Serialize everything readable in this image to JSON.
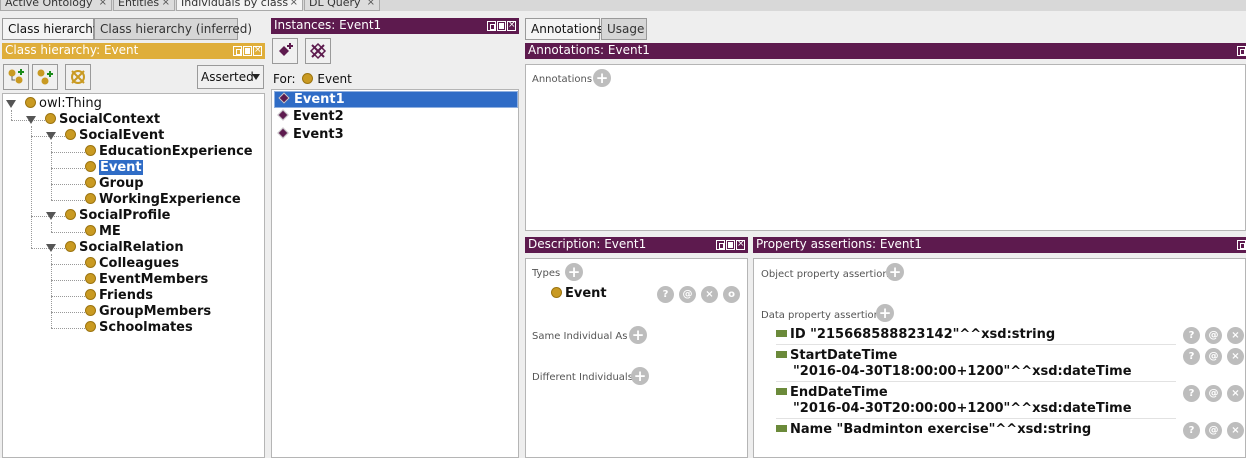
{
  "top_tabs": [
    {
      "label": "Active Ontology",
      "active": false
    },
    {
      "label": "Entities",
      "active": false
    },
    {
      "label": "Individuals by class",
      "active": true
    },
    {
      "label": "DL Query",
      "active": false
    }
  ],
  "left": {
    "tabs": [
      "Class hierarchy",
      "Class hierarchy (inferred)"
    ],
    "panel_title": "Class hierarchy: Event",
    "dropdown_value": "Asserted",
    "tree": {
      "root": "owl:Thing",
      "social_context": "SocialContext",
      "social_event": "SocialEvent",
      "education_experience": "EducationExperience",
      "event": "Event",
      "group": "Group",
      "working_experience": "WorkingExperience",
      "social_profile": "SocialProfile",
      "me": "ME",
      "social_relation": "SocialRelation",
      "colleagues": "Colleagues",
      "event_members": "EventMembers",
      "friends": "Friends",
      "group_members": "GroupMembers",
      "schoolmates": "Schoolmates"
    }
  },
  "instances": {
    "panel_title": "Instances: Event1",
    "for_label": "For:",
    "for_class": "Event",
    "items": [
      "Event1",
      "Event2",
      "Event3"
    ]
  },
  "right_tabs": [
    "Annotations",
    "Usage"
  ],
  "annotations": {
    "panel_title": "Annotations: Event1",
    "label": "Annotations"
  },
  "description": {
    "panel_title": "Description: Event1",
    "types_label": "Types",
    "type_value": "Event",
    "same_label": "Same Individual As",
    "different_label": "Different Individuals"
  },
  "properties": {
    "panel_title": "Property assertions: Event1",
    "object_label": "Object property assertions",
    "data_label": "Data property assertions",
    "rows": [
      {
        "line1": "ID  \"215668588823142\"^^xsd:string",
        "line2": ""
      },
      {
        "line1": "StartDateTime",
        "line2": "\"2016-04-30T18:00:00+1200\"^^xsd:dateTime"
      },
      {
        "line1": "EndDateTime",
        "line2": "\"2016-04-30T20:00:00+1200\"^^xsd:dateTime"
      },
      {
        "line1": "Name  \"Badminton exercise\"^^xsd:string",
        "line2": ""
      }
    ]
  },
  "action_glyphs": {
    "help": "?",
    "annotate": "@",
    "delete": "×",
    "edit": "o"
  }
}
